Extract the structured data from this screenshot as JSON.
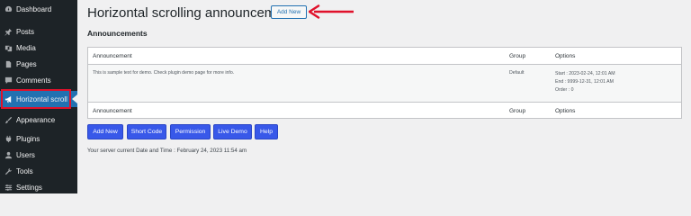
{
  "sidebar": {
    "items": [
      {
        "label": "Dashboard",
        "icon": "dashboard-icon"
      },
      {
        "label": "Posts",
        "icon": "pin-icon"
      },
      {
        "label": "Media",
        "icon": "media-icon"
      },
      {
        "label": "Pages",
        "icon": "page-icon"
      },
      {
        "label": "Comments",
        "icon": "comment-icon"
      },
      {
        "label": "Horizontal scroll",
        "icon": "megaphone-icon"
      },
      {
        "label": "Appearance",
        "icon": "brush-icon"
      },
      {
        "label": "Plugins",
        "icon": "plug-icon"
      },
      {
        "label": "Users",
        "icon": "user-icon"
      },
      {
        "label": "Tools",
        "icon": "wrench-icon"
      },
      {
        "label": "Settings",
        "icon": "settings-icon"
      }
    ]
  },
  "header": {
    "title": "Horizontal scrolling announcements",
    "add_new_label": "Add New"
  },
  "section": {
    "title": "Announcements"
  },
  "table": {
    "columns": [
      "Announcement",
      "Group",
      "Options"
    ],
    "rows": [
      {
        "announcement": "This is sample text for demo. Check plugin demo page for more info.",
        "group": "Default",
        "options": [
          "Start : 2023-02-24, 12:01 AM",
          "End : 9999-12-31, 12:01 AM",
          "Order : 0"
        ]
      }
    ]
  },
  "buttons": {
    "add_new": "Add New",
    "short_code": "Short Code",
    "permission": "Permission",
    "live_demo": "Live Demo",
    "help": "Help"
  },
  "footer": {
    "server_time": "Your server current Date and Time : February 24, 2023 11:54 am"
  },
  "colors": {
    "sidebar_bg": "#1d2327",
    "active_menu": "#2271b1",
    "button_blue": "#3858e9",
    "annotation_red": "#e0112b"
  }
}
